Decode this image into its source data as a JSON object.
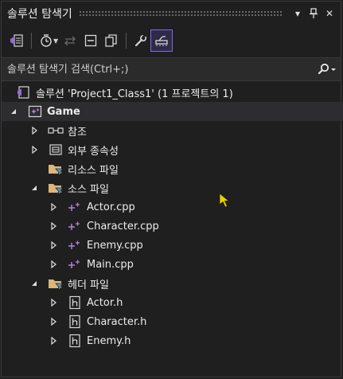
{
  "window": {
    "title": "솔루션 탐색기",
    "dropdown_glyph": "▾",
    "pin_glyph": "†",
    "close_glyph": "✕"
  },
  "search": {
    "placeholder": "솔루션 탐색기 검색(Ctrl+;)"
  },
  "colors": {
    "accent": "#7c6dd8",
    "folder": "#dcb67a",
    "cpp": "#b180d7",
    "cursor": "#e8d200"
  },
  "tree": {
    "solution": "솔루션 'Project1_Class1' (1 프로젝트의 1)",
    "project": "Game",
    "references": "참조",
    "external_deps": "외부 종속성",
    "resource_files": "리소스 파일",
    "source_files": "소스 파일",
    "sources": [
      "Actor.cpp",
      "Character.cpp",
      "Enemy.cpp",
      "Main.cpp"
    ],
    "header_files": "헤더 파일",
    "headers": [
      "Actor.h",
      "Character.h",
      "Enemy.h"
    ]
  }
}
